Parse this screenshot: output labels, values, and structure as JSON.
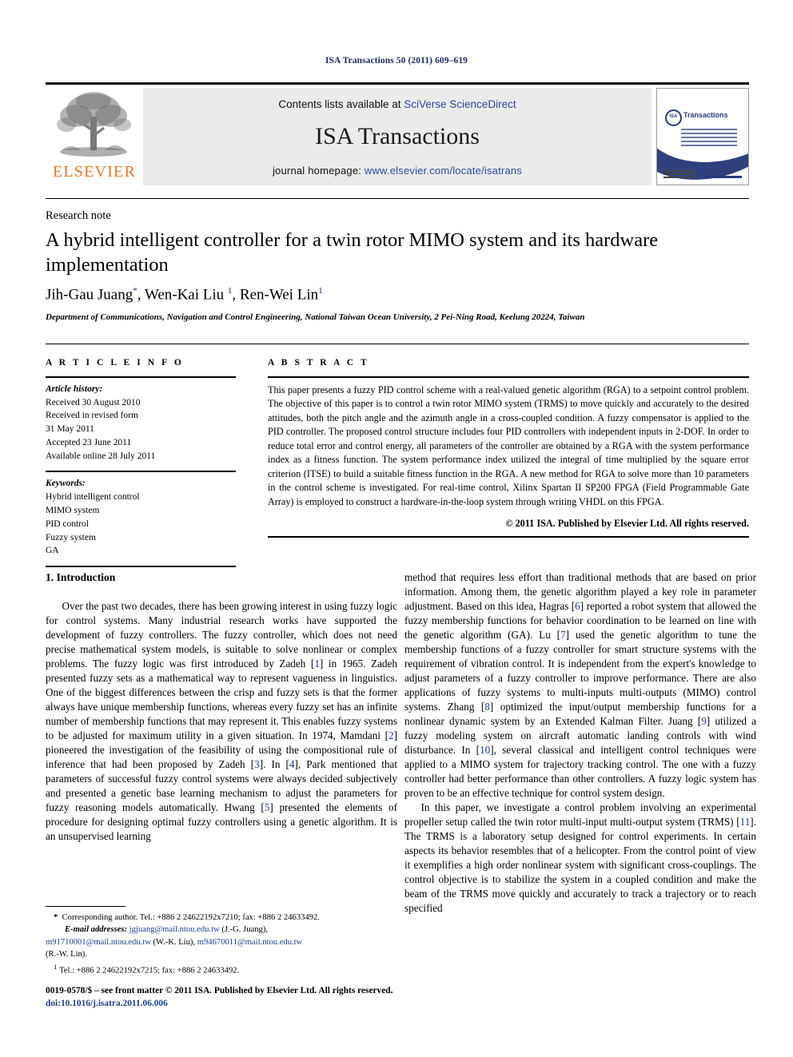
{
  "running_head": "ISA Transactions 50 (2011) 609–619",
  "masthead": {
    "contents_prefix": "Contents lists available at ",
    "contents_link": "SciVerse ScienceDirect",
    "journal_title": "ISA Transactions",
    "homepage_prefix": "journal homepage: ",
    "homepage_link": "www.elsevier.com/locate/isatrans",
    "publisher_logo_text": "ELSEVIER",
    "cover_isa": "ISA",
    "cover_transactions": "Transactions"
  },
  "article": {
    "doctype": "Research note",
    "title": "A hybrid intelligent controller for a twin rotor MIMO system and its hardware implementation",
    "author1": "Jih-Gau Juang",
    "author2": "Wen-Kai Liu",
    "author3": "Ren-Wei Lin",
    "affiliation": "Department of Communications, Navigation and Control Engineering, National Taiwan Ocean University, 2 Pei-Ning Road, Keelung 20224, Taiwan"
  },
  "info": {
    "heading": "A R T I C L E    I N F O",
    "history_label": "Article history:",
    "history": [
      "Received 30 August 2010",
      "Received in revised form",
      "31 May 2011",
      "Accepted 23 June 2011",
      "Available online 28 July 2011"
    ],
    "keywords_label": "Keywords:",
    "keywords": [
      "Hybrid intelligent control",
      "MIMO system",
      "PID control",
      "Fuzzy system",
      "GA"
    ]
  },
  "abstract": {
    "heading": "A B S T R A C T",
    "text": "This paper presents a fuzzy PID control scheme with a real-valued genetic algorithm (RGA) to a setpoint control problem. The objective of this paper is to control a twin rotor MIMO system (TRMS) to move quickly and accurately to the desired attitudes, both the pitch angle and the azimuth angle in a cross-coupled condition. A fuzzy compensator is applied to the PID controller. The proposed control structure includes four PID controllers with independent inputs in 2-DOF. In order to reduce total error and control energy, all parameters of the controller are obtained by a RGA with the system performance index as a fitness function. The system performance index utilized the integral of time multiplied by the square error criterion (ITSE) to build a suitable fitness function in the RGA. A new method for RGA to solve more than 10 parameters in the control scheme is investigated. For real-time control, Xilinx Spartan II SP200 FPGA (Field Programmable Gate Array) is employed to construct a hardware-in-the-loop system through writing VHDL on this FPGA.",
    "copyright": "© 2011 ISA. Published by Elsevier Ltd. All rights reserved."
  },
  "body": {
    "section_heading": "1. Introduction",
    "left_para_1_a": "Over the past two decades, there has been growing interest in using fuzzy logic for control systems. Many industrial research works have supported the development of fuzzy controllers. The fuzzy controller, which does not need precise mathematical system models, is suitable to solve nonlinear or complex problems. The fuzzy logic was first introduced by Zadeh [",
    "ref1": "1",
    "left_para_1_b": "] in 1965. Zadeh presented fuzzy sets as a mathematical way to represent vagueness in linguistics. One of the biggest differences between the crisp and fuzzy sets is that the former always have unique membership functions, whereas every fuzzy set has an infinite number of membership functions that may represent it. This enables fuzzy systems to be adjusted for maximum utility in a given situation. In 1974, Mamdani [",
    "ref2": "2",
    "left_para_1_c": "] pioneered the investigation of the feasibility of using the compositional rule of inference that had been proposed by Zadeh [",
    "ref3": "3",
    "left_para_1_d": "]. In [",
    "ref4": "4",
    "left_para_1_e": "], Park mentioned that parameters of successful fuzzy control systems were always decided subjectively and presented a genetic base learning mechanism to adjust the parameters for fuzzy reasoning models automatically. Hwang [",
    "ref5": "5",
    "left_para_1_f": "] presented the elements of procedure for designing optimal fuzzy controllers using a genetic algorithm. It is an unsupervised learning",
    "right_para_1_a": "method that requires less effort than traditional methods that are based on prior information. Among them, the genetic algorithm played a key role in parameter adjustment. Based on this idea, Hagras [",
    "ref6": "6",
    "right_para_1_b": "] reported a robot system that allowed the fuzzy membership functions for behavior coordination to be learned on line with the genetic algorithm (GA). Lu [",
    "ref7": "7",
    "right_para_1_c": "] used the genetic algorithm to tune the membership functions of a fuzzy controller for smart structure systems with the requirement of vibration control. It is independent from the expert's knowledge to adjust parameters of a fuzzy controller to improve performance. There are also applications of fuzzy systems to multi-inputs multi-outputs (MIMO) control systems. Zhang [",
    "ref8": "8",
    "right_para_1_d": "] optimized the input/output membership functions for a nonlinear dynamic system by an Extended Kalman Filter. Juang [",
    "ref9": "9",
    "right_para_1_e": "] utilized a fuzzy modeling system on aircraft automatic landing controls with wind disturbance. In [",
    "ref10": "10",
    "right_para_1_f": "], several classical and intelligent control techniques were applied to a MIMO system for trajectory tracking control. The one with a fuzzy controller had better performance than other controllers. A fuzzy logic system has proven to be an effective technique for control system design.",
    "right_para_2_a": "In this paper, we investigate a control problem involving an experimental propeller setup called the twin rotor multi-input multi-output system (TRMS) [",
    "ref11": "11",
    "right_para_2_b": "]. The TRMS is a laboratory setup designed for control experiments. In certain aspects its behavior resembles that of a helicopter. From the control point of view it exemplifies a high order nonlinear system with significant cross-couplings. The control objective is to stabilize the system in a coupled condition and make the beam of the TRMS move quickly and accurately to track a trajectory or to reach specified"
  },
  "footnotes": {
    "star": "*",
    "corr_author": "Corresponding author. Tel.: +886 2 24622192x7210; fax: +886 2 24633492.",
    "email_label": "E-mail addresses:",
    "email1": "jgjuang@mail.ntou.edu.tw",
    "email1_owner": "(J.-G. Juang),",
    "email2": "m91710001@mail.ntou.edu.tw",
    "email2_owner": "(W.-K. Liu),",
    "email3": "m94670011@mail.ntou.edu.tw",
    "email3_owner": "(R.-W. Lin).",
    "fn1_marker": "1",
    "fn1_text": "Tel.: +886 2 24622192x7215; fax: +886 2 24633492."
  },
  "issn": {
    "line1": "0019-0578/$ – see front matter © 2011 ISA. Published by Elsevier Ltd. All rights reserved.",
    "doi": "doi:10.1016/j.isatra.2011.06.006"
  }
}
